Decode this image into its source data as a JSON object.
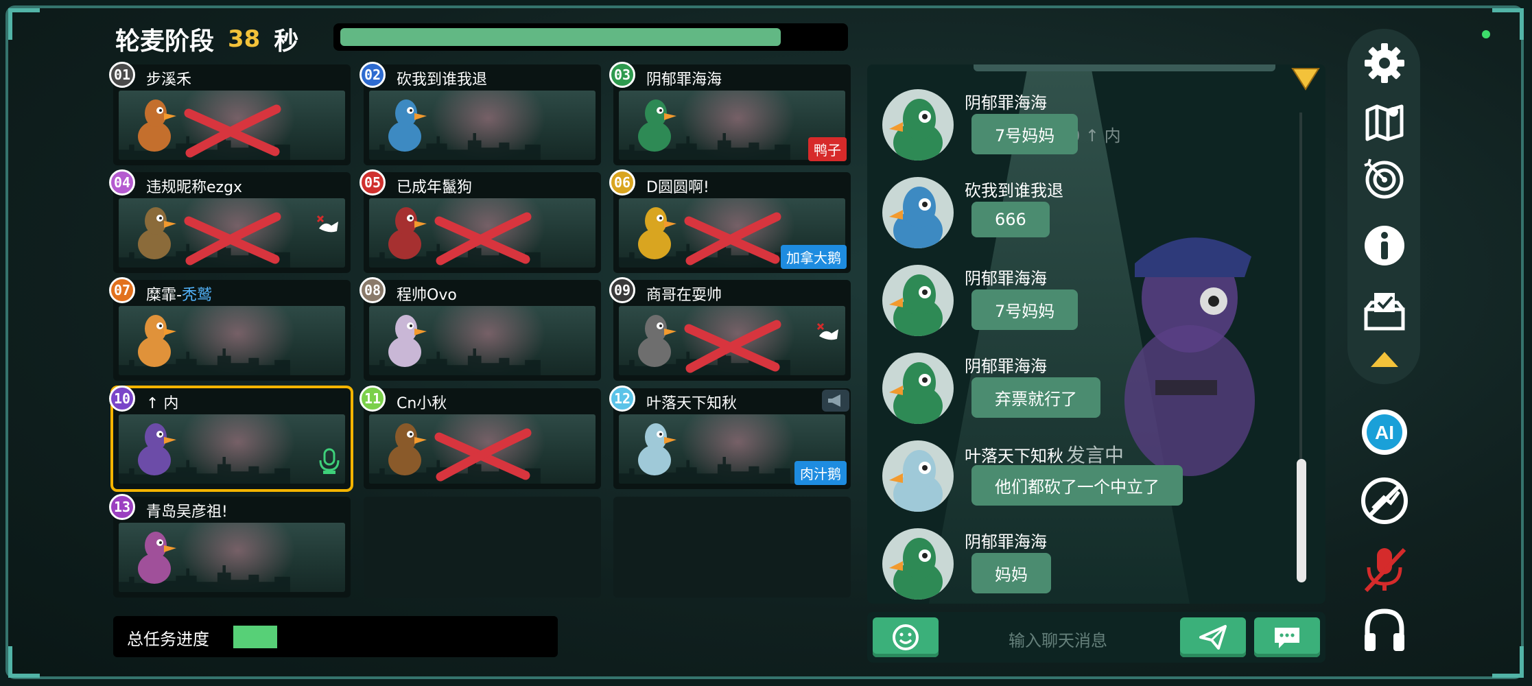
{
  "phase": {
    "title": "轮麦阶段",
    "seconds": "38",
    "unit": "秒",
    "timer_fraction": 0.88
  },
  "players": [
    {
      "num": "01",
      "name": "步溪禾",
      "badge_color": "#4b4b4b",
      "eliminated": true
    },
    {
      "num": "02",
      "name": "砍我到谁我退",
      "badge_color": "#2e6bd0",
      "eliminated": false
    },
    {
      "num": "03",
      "name": "阴郁罪海海",
      "badge_color": "#2e9a4e",
      "eliminated": false,
      "tag": "鸭子",
      "tag_color": "red"
    },
    {
      "num": "04",
      "name": "违规昵称ezgx",
      "badge_color": "#b55bd0",
      "eliminated": true,
      "dead_icon": true
    },
    {
      "num": "05",
      "name": "已成年鬣狗",
      "badge_color": "#d0312e",
      "eliminated": true
    },
    {
      "num": "06",
      "name": "D圆圆啊!",
      "badge_color": "#d9a520",
      "eliminated": true,
      "tag": "加拿大鹅",
      "tag_color": "blue"
    },
    {
      "num": "07",
      "name_pre": "糜霏-",
      "name_hl": "秃鹫",
      "badge_color": "#e2711d",
      "eliminated": false
    },
    {
      "num": "08",
      "name": "程帅Ovo",
      "badge_color": "#8a7a6a",
      "eliminated": false
    },
    {
      "num": "09",
      "name": "商哥在耍帅",
      "badge_color": "#3a3a3a",
      "eliminated": true,
      "dead_icon": true
    },
    {
      "num": "10",
      "name": "↑ 内",
      "badge_color": "#7a45c9",
      "eliminated": false,
      "selected": true
    },
    {
      "num": "11",
      "name": "Cn小秋",
      "badge_color": "#7bd04a",
      "eliminated": true
    },
    {
      "num": "12",
      "name": "叶落天下知秋",
      "badge_color": "#5bc3e8",
      "eliminated": false,
      "tag": "肉汁鹅",
      "tag_color": "blue",
      "voice": true
    },
    {
      "num": "13",
      "name": "青岛吴彦祖!",
      "badge_color": "#9b3fc0",
      "eliminated": false
    }
  ],
  "task_progress": {
    "label": "总任务进度",
    "fraction": 0.16
  },
  "chat": {
    "ghost_text": "0 ↑ 内",
    "messages": [
      {
        "name": "阴郁罪海海",
        "text": "7号妈妈"
      },
      {
        "name": "砍我到谁我退",
        "text": "666"
      },
      {
        "name": "阴郁罪海海",
        "text": "7号妈妈"
      },
      {
        "name": "阴郁罪海海",
        "text": "弃票就行了"
      },
      {
        "name": "叶落天下知秋",
        "speaking": "发言中",
        "text": "他们都砍了一个中立了"
      },
      {
        "name": "阴郁罪海海",
        "text": "妈妈"
      }
    ],
    "placeholder": "输入聊天消息"
  },
  "sidebar": {
    "icons": [
      "gear-icon",
      "map-icon",
      "target-icon",
      "info-icon",
      "vote-box-icon",
      "collapse-arrow-icon",
      "ai-icon",
      "no-report-icon",
      "mic-muted-icon",
      "headphones-icon"
    ]
  },
  "ai_label": "AI",
  "colors": {
    "accent": "#35746d",
    "highlight": "#f4b400",
    "bubble": "#4b8c70"
  }
}
